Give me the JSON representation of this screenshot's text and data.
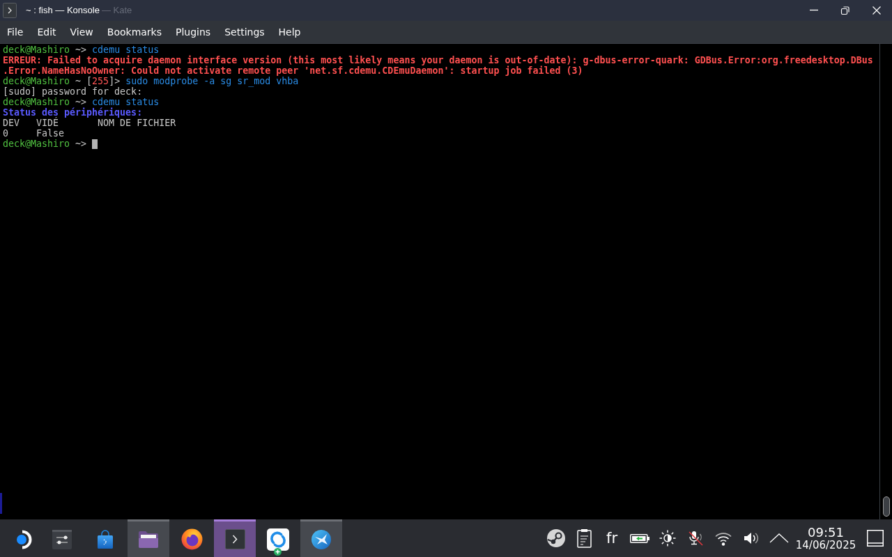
{
  "window": {
    "title": "~ : fish — Konsole",
    "fading_title": "— Kate"
  },
  "menu": [
    "File",
    "Edit",
    "View",
    "Bookmarks",
    "Plugins",
    "Settings",
    "Help"
  ],
  "terminal": {
    "lines": [
      {
        "segments": [
          {
            "text": "deck@Mashiro",
            "kind": "user"
          },
          {
            "text": " ~> ",
            "kind": "path"
          },
          {
            "text": "cdemu status",
            "kind": "command"
          }
        ]
      },
      {
        "segments": [
          {
            "text": "ERREUR: Failed to acquire daemon interface version (this most likely means your daemon is out-of-date): g-dbus-error-quark: GDBus.Error:org.freedesktop.DBus\n.Error.NameHasNoOwner: Could not activate remote peer 'net.sf.cdemu.CDEmuDaemon': startup job failed (3)",
            "kind": "error"
          }
        ]
      },
      {
        "segments": [
          {
            "text": "deck@Mashiro",
            "kind": "user"
          },
          {
            "text": " ~ [",
            "kind": "path"
          },
          {
            "text": "255",
            "kind": "status"
          },
          {
            "text": "]> ",
            "kind": "path"
          },
          {
            "text": "sudo modprobe -a sg sr_mod vhba",
            "kind": "command"
          }
        ]
      },
      {
        "segments": [
          {
            "text": "[sudo] password for deck:",
            "kind": "plain"
          }
        ]
      },
      {
        "segments": [
          {
            "text": "deck@Mashiro",
            "kind": "user"
          },
          {
            "text": " ~> ",
            "kind": "path"
          },
          {
            "text": "cdemu status",
            "kind": "command"
          }
        ]
      },
      {
        "segments": [
          {
            "text": "Status des périphériques:",
            "kind": "heading"
          }
        ]
      },
      {
        "segments": [
          {
            "text": "DEV   VIDÉ       NOM DE FICHIER",
            "kind": "plain"
          }
        ]
      },
      {
        "segments": [
          {
            "text": "0     False",
            "kind": "plain"
          }
        ]
      },
      {
        "segments": [
          {
            "text": "deck@Mashiro",
            "kind": "user"
          },
          {
            "text": " ~> ",
            "kind": "path"
          }
        ]
      }
    ],
    "cursor": true
  },
  "taskbar": [
    {
      "kind": "launcher",
      "open": false,
      "selected": false
    },
    {
      "kind": "mixer",
      "open": false,
      "selected": false
    },
    {
      "kind": "store",
      "open": false,
      "selected": false
    },
    {
      "kind": "files",
      "open": true,
      "selected": false
    },
    {
      "kind": "browser",
      "open": false,
      "selected": false
    },
    {
      "kind": "terminal",
      "open": true,
      "selected": true
    },
    {
      "kind": "sync",
      "open": false,
      "selected": false
    },
    {
      "kind": "bird",
      "open": true,
      "selected": false
    }
  ],
  "tray": [
    {
      "kind": "emblem"
    },
    {
      "kind": "clipboard"
    },
    {
      "kind": "language",
      "text": "fr"
    },
    {
      "kind": "battery",
      "charging": true
    },
    {
      "kind": "brightness"
    },
    {
      "kind": "microphone",
      "muted": true
    },
    {
      "kind": "wifi"
    },
    {
      "kind": "volume"
    },
    {
      "kind": "expand"
    }
  ],
  "clock": {
    "time": "09:51",
    "date": "14/06/2025"
  }
}
